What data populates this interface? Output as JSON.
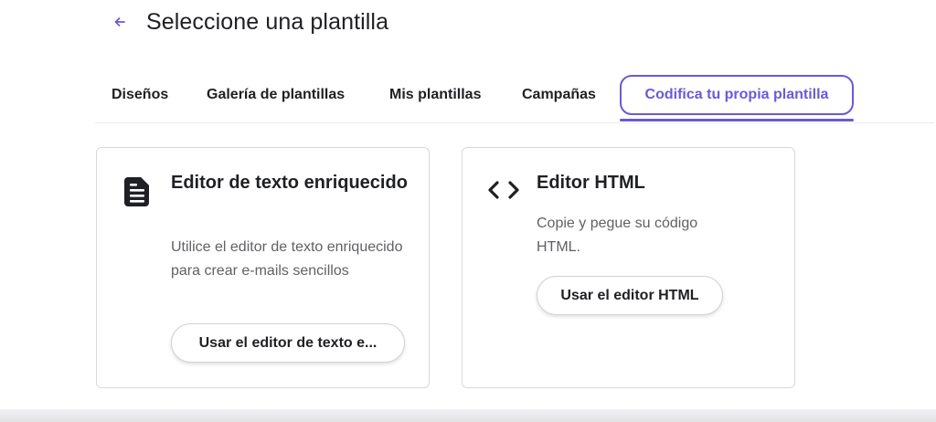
{
  "header": {
    "back_icon": "arrow-left-icon",
    "title": "Seleccione una plantilla"
  },
  "tabs": [
    {
      "label": "Diseños",
      "active": false
    },
    {
      "label": "Galería de plantillas",
      "active": false
    },
    {
      "label": "Mis plantillas",
      "active": false
    },
    {
      "label": "Campañas",
      "active": false
    },
    {
      "label": "Codifica tu propia plantilla",
      "active": true
    }
  ],
  "cards": [
    {
      "icon": "document-icon",
      "title": "Editor de texto enriquecido",
      "description": "Utilice el editor de texto enriquecido para crear e-mails sencillos",
      "button_label": "Usar el editor de texto e..."
    },
    {
      "icon": "code-icon",
      "title": "Editor HTML",
      "description": "Copie y pegue su código HTML.",
      "button_label": "Usar el editor HTML"
    }
  ],
  "colors": {
    "accent": "#6a5ad6",
    "text": "#1f2023",
    "muted": "#616166",
    "border": "#d7d8dc"
  }
}
